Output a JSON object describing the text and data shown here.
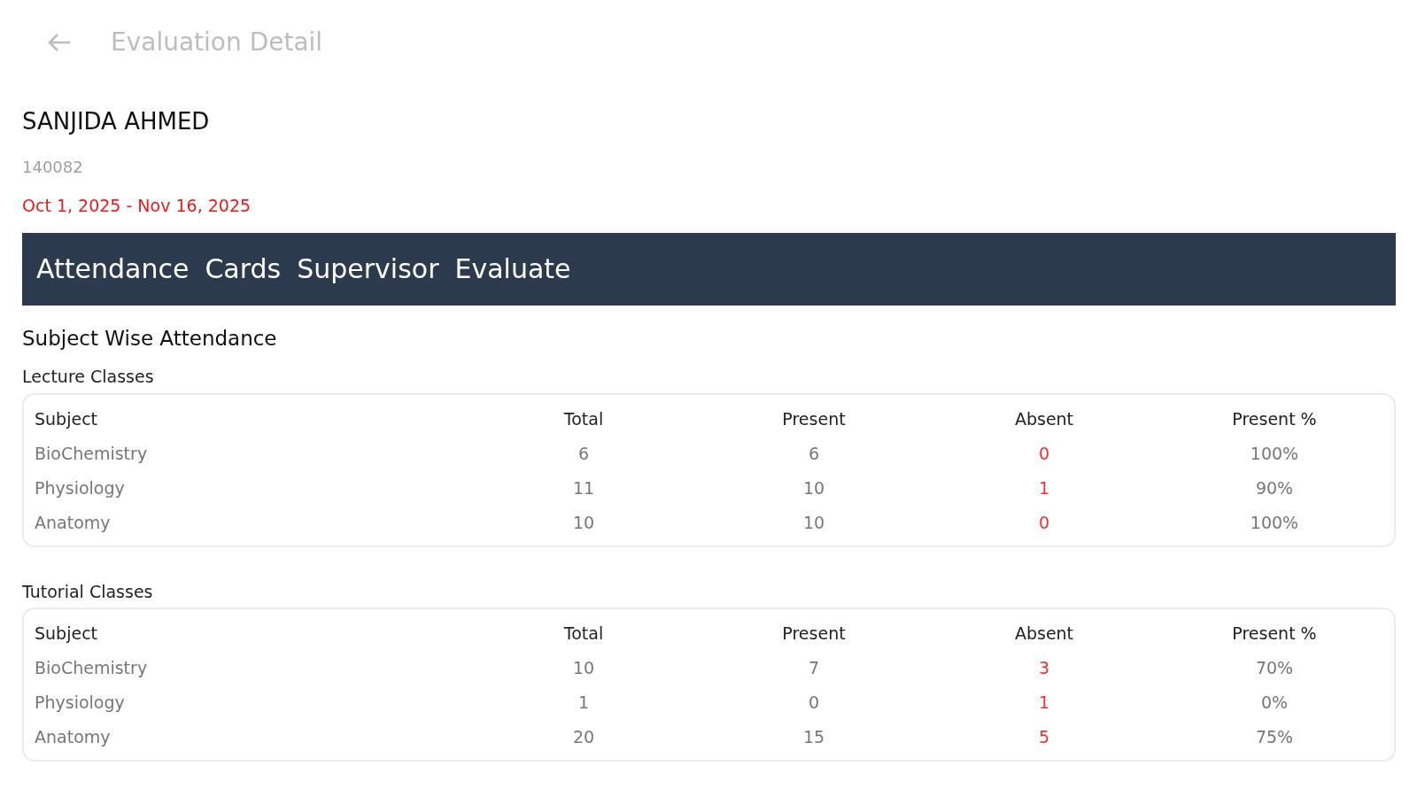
{
  "header": {
    "title": "Evaluation Detail"
  },
  "student": {
    "name": "SANJIDA AHMED",
    "id": "140082",
    "date_range": "Oct 1, 2025 - Nov 16, 2025"
  },
  "tabs": [
    "Attendance",
    "Cards",
    "Supervisor",
    "Evaluate"
  ],
  "section_title": "Subject Wise Attendance",
  "tables": [
    {
      "title": "Lecture Classes",
      "columns": [
        "Subject",
        "Total",
        "Present",
        "Absent",
        "Present %"
      ],
      "rows": [
        [
          "BioChemistry",
          "6",
          "6",
          "0",
          "100%"
        ],
        [
          "Physiology",
          "11",
          "10",
          "1",
          "90%"
        ],
        [
          "Anatomy",
          "10",
          "10",
          "0",
          "100%"
        ]
      ]
    },
    {
      "title": "Tutorial Classes",
      "columns": [
        "Subject",
        "Total",
        "Present",
        "Absent",
        "Present %"
      ],
      "rows": [
        [
          "BioChemistry",
          "10",
          "7",
          "3",
          "70%"
        ],
        [
          "Physiology",
          "1",
          "0",
          "1",
          "0%"
        ],
        [
          "Anatomy",
          "20",
          "15",
          "5",
          "75%"
        ]
      ]
    }
  ]
}
